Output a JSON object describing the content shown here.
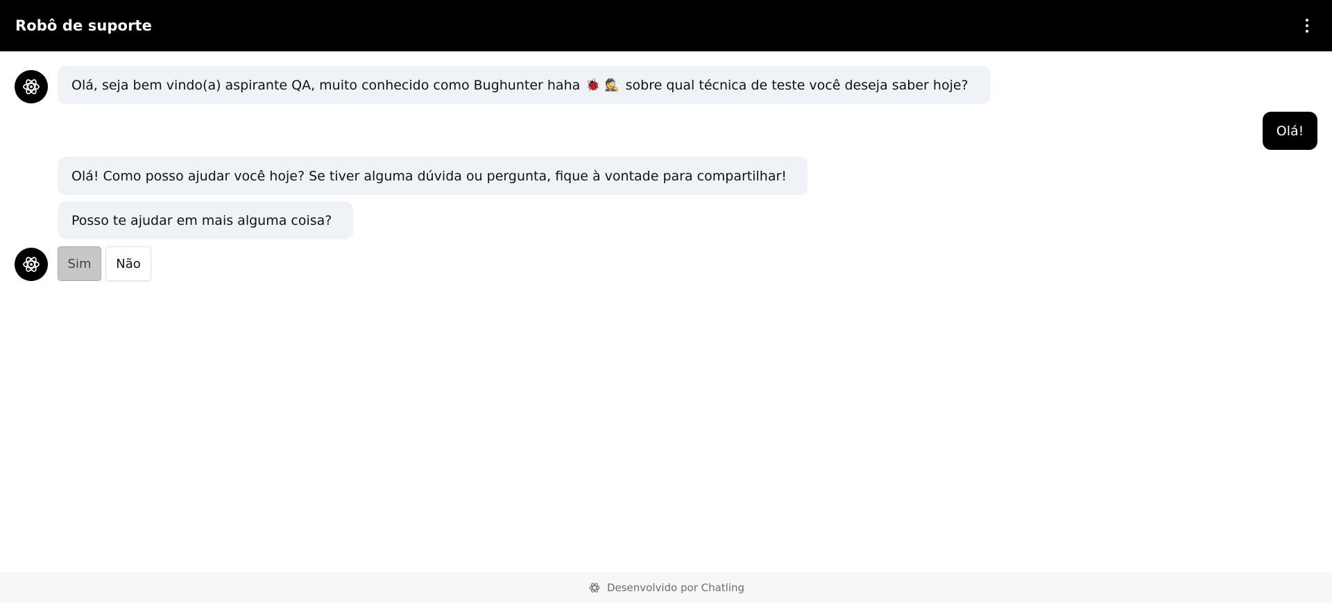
{
  "header": {
    "title": "Robô de suporte",
    "menu_icon": "more-vertical-icon"
  },
  "messages": [
    {
      "sender": "bot",
      "parts": [
        "Olá, seja bem vindo(a) aspirante QA, muito conhecido como Bughunter haha",
        "🐞",
        "🕵",
        "sobre qual técnica de teste você deseja saber hoje?"
      ]
    },
    {
      "sender": "user",
      "text": "Olá!"
    },
    {
      "sender": "bot",
      "text": "Olá! Como posso ajudar você hoje? Se tiver alguma dúvida ou pergunta, fique à vontade para compartilhar!"
    },
    {
      "sender": "bot",
      "text": "Posso te ajudar em mais alguma coisa?"
    }
  ],
  "quick_replies": {
    "yes": "Sim",
    "no": "Não"
  },
  "footer": {
    "text": "Desenvolvido por Chatling",
    "icon": "chatling-logo-icon"
  },
  "colors": {
    "header_bg": "#000000",
    "bot_bubble_bg": "#eff3f8",
    "user_bubble_bg": "#000000",
    "footer_bg": "#f6f7f9"
  }
}
